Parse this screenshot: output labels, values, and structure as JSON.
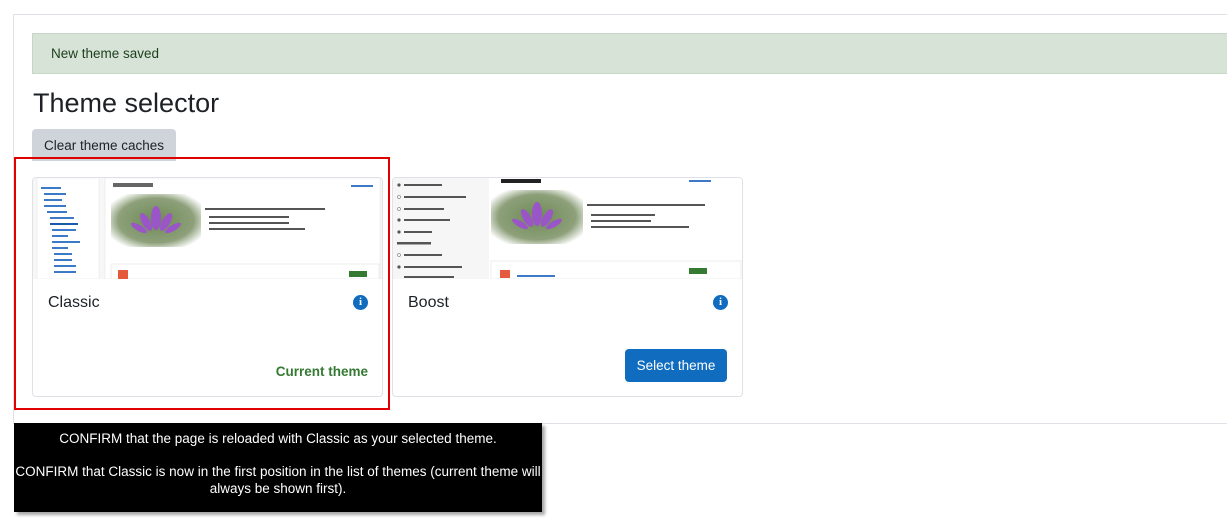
{
  "alert": {
    "text": "New theme saved"
  },
  "page_title": "Theme selector",
  "clear_caches_label": "Clear theme caches",
  "themes": [
    {
      "name": "Classic",
      "status_label": "Current theme"
    },
    {
      "name": "Boost",
      "action_label": "Select theme"
    }
  ],
  "annotation": {
    "line1": "CONFIRM that the page is reloaded with Classic as your selected theme.",
    "line2": "CONFIRM that Classic is now in the first position in the list of themes (current theme will always be shown first)."
  },
  "colors": {
    "alert_bg": "#d7e3d7",
    "primary": "#0f6cbf",
    "success": "#357a32",
    "highlight": "#e00000"
  }
}
